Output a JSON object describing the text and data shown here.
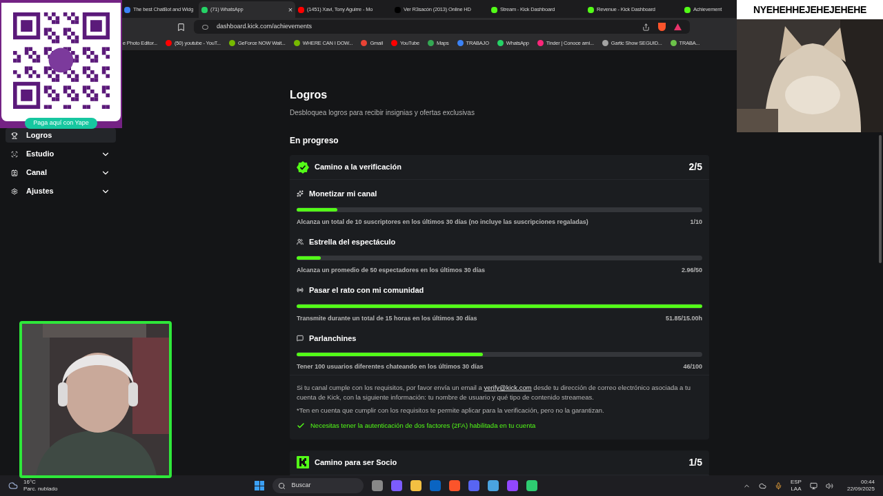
{
  "browser": {
    "tabs": [
      {
        "label": "The best ChatBot and Widg",
        "selected": false,
        "color": "#3b82f6"
      },
      {
        "label": "(71) WhatsApp",
        "selected": true,
        "color": "#25d366"
      },
      {
        "label": "(1451) Xavi, Tony Aguirre - Mo",
        "selected": false,
        "color": "#ff0000"
      },
      {
        "label": "Ver R3sacón (2013) Online HD",
        "selected": false,
        "color": "#000000"
      },
      {
        "label": "Stream - Kick Dashboard",
        "selected": false,
        "color": "#53fc18"
      },
      {
        "label": "Revenue - Kick Dashboard",
        "selected": false,
        "color": "#53fc18"
      },
      {
        "label": "Achievement",
        "selected": false,
        "color": "#53fc18"
      }
    ],
    "close_tab": "×",
    "url": "dashboard.kick.com/achievements",
    "bookmarks": [
      {
        "label": "e Photo Editor..."
      },
      {
        "label": "(50) youtube - YouT...",
        "color": "#ff0000"
      },
      {
        "label": "GeForce NOW Wait...",
        "color": "#76b900"
      },
      {
        "label": "WHERE CAN I DOW...",
        "color": "#76b900"
      },
      {
        "label": "Gmail",
        "color": "#ea4335"
      },
      {
        "label": "YouTube",
        "color": "#ff0000"
      },
      {
        "label": "Maps",
        "color": "#34a853"
      },
      {
        "label": "TRABAJO",
        "color": "#3b82f6"
      },
      {
        "label": "WhatsApp",
        "color": "#25d366"
      },
      {
        "label": "Tinder | Conoce ami...",
        "color": "#fd267a"
      },
      {
        "label": "Gartic Show SEGUID...",
        "color": "#a3a3a3"
      },
      {
        "label": "TRABA...",
        "color": "#6cc24a"
      }
    ]
  },
  "sidebar": {
    "items": [
      {
        "label": "Logros",
        "selected": true,
        "expandable": false
      },
      {
        "label": "Estudio",
        "selected": false,
        "expandable": true
      },
      {
        "label": "Canal",
        "selected": false,
        "expandable": true
      },
      {
        "label": "Ajustes",
        "selected": false,
        "expandable": true
      }
    ]
  },
  "page": {
    "title": "Logros",
    "subtitle": "Desbloquea logros para recibir insignias y ofertas exclusivas",
    "section": "En progreso",
    "cards": [
      {
        "title": "Camino a la verificación",
        "count": "2/5",
        "kind": "verified",
        "tasks": [
          {
            "title": "Monetizar mi canal",
            "level": 0.1,
            "description": "Alcanza un total de 10 suscriptores en los últimos 30 días (no incluye las suscripciones regaladas)",
            "progress": "1/10"
          },
          {
            "title": "Estrella del espectáculo",
            "level": 0.06,
            "description": "Alcanza un promedio de 50 espectadores en los últimos 30 días",
            "progress": "2.96/50"
          },
          {
            "title": "Pasar el rato con mi comunidad",
            "level": 1,
            "description": "Transmite durante un total de 15 horas en los últimos 30 días",
            "progress": "51.85/15.00h"
          },
          {
            "title": "Parlanchines",
            "level": 0.46,
            "description": "Tener 100 usuarios diferentes chateando en los últimos 30 días",
            "progress": "46/100"
          }
        ],
        "note": {
          "before": "Si tu canal cumple con los requisitos, por favor envía un email a ",
          "link": "verify@kick.com",
          "after": " desde tu dirección de correo electrónico asociada a tu cuenta de Kick, con la siguiente información: tu nombre de usuario y qué tipo de contenido streameas.",
          "disclaimer": "*Ten en cuenta que cumplir con los requisitos te permite aplicar para la verificación, pero no la garantizan.",
          "requirement": "Necesitas tener la autenticación de dos factores (2FA) habilitada en tu cuenta",
          "requirement_met": true
        }
      },
      {
        "title": "Camino para ser Socio",
        "count": "1/5",
        "kind": "partner"
      }
    ]
  },
  "overlays": {
    "qr": {
      "button": "Paga aquí con Yape"
    },
    "meme": {
      "caption": "NYEHEHHEJEHEJEHEHE"
    }
  },
  "taskbar": {
    "temperature": "16°C",
    "weather": "Parc. nublado",
    "search": "Buscar",
    "lang": "ESP",
    "layout": "LAA",
    "time": "00:44",
    "date": "22/09/2025"
  }
}
